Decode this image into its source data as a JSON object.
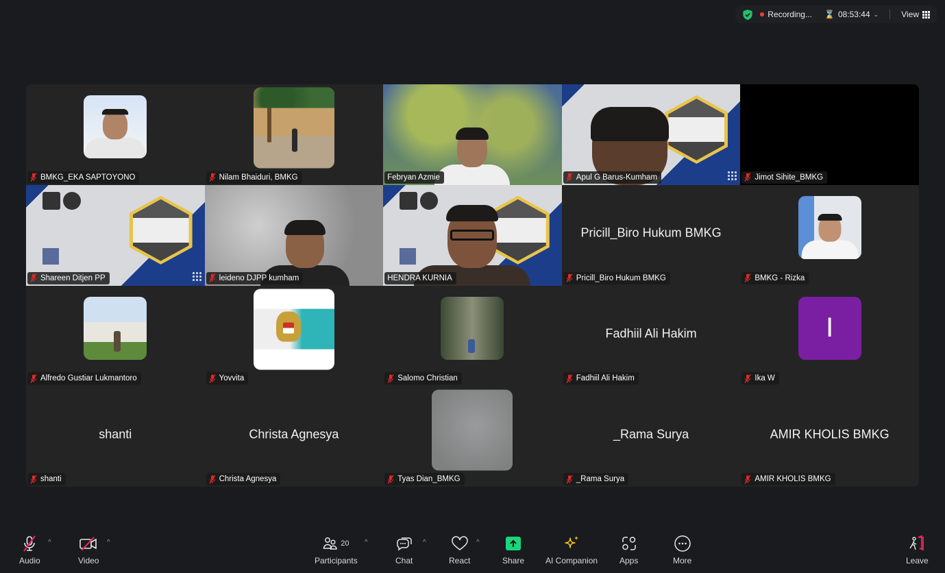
{
  "topbar": {
    "security_icon": "shield-check-icon",
    "recording_label": "Recording...",
    "timer": "08:53:44",
    "view_label": "View",
    "colors": {
      "shield": "#23c16b",
      "recording_dot": "#ff3b3b"
    }
  },
  "gallery": {
    "active_speaker": "HENDRA KURNIA",
    "active_border_color": "#23d959",
    "tiles": [
      {
        "name": "BMKG_EKA SAPTOYONO",
        "muted": true,
        "display": "avatar-photo"
      },
      {
        "name": "Nilam Bhaiduri, BMKG",
        "muted": true,
        "display": "avatar-photo"
      },
      {
        "name": "Febryan Azmie",
        "muted": false,
        "display": "video"
      },
      {
        "name": "Apul G Barus-Kumham",
        "muted": true,
        "display": "video"
      },
      {
        "name": "Jimot Sihite_BMKG",
        "muted": true,
        "display": "black-video"
      },
      {
        "name": "Shareen Ditjen PP",
        "muted": true,
        "display": "video"
      },
      {
        "name": "leideno DJPP kumham",
        "muted": true,
        "display": "video"
      },
      {
        "name": "HENDRA KURNIA",
        "muted": false,
        "display": "video"
      },
      {
        "name": "Pricill_Biro Hukum BMKG",
        "muted": true,
        "display": "name-only",
        "center_name": "Pricill_Biro Hukum BMKG"
      },
      {
        "name": "BMKG - Rizka",
        "muted": true,
        "display": "avatar-photo"
      },
      {
        "name": "Alfredo Gustiar Lukmantoro",
        "muted": true,
        "display": "avatar-photo"
      },
      {
        "name": "Yovvita",
        "muted": true,
        "display": "avatar-photo"
      },
      {
        "name": "Salomo Christian",
        "muted": true,
        "display": "avatar-photo"
      },
      {
        "name": "Fadhiil Ali Hakim",
        "muted": true,
        "display": "name-only",
        "center_name": "Fadhiil Ali Hakim"
      },
      {
        "name": "Ika W",
        "muted": true,
        "display": "avatar-letter",
        "avatar_letter": "I",
        "avatar_color": "#7a1fa2"
      },
      {
        "name": "shanti",
        "muted": true,
        "display": "name-only",
        "center_name": "shanti"
      },
      {
        "name": "Christa Agnesya",
        "muted": true,
        "display": "name-only",
        "center_name": "Christa Agnesya"
      },
      {
        "name": "Tyas Dian_BMKG",
        "muted": true,
        "display": "avatar-photo"
      },
      {
        "name": "_Rama Surya",
        "muted": true,
        "display": "name-only",
        "center_name": "_Rama Surya"
      },
      {
        "name": "AMIR KHOLIS BMKG",
        "muted": true,
        "display": "name-only",
        "center_name": "AMIR KHOLIS BMKG"
      }
    ]
  },
  "toolbar": {
    "audio": {
      "label": "Audio",
      "icon": "microphone-muted-icon"
    },
    "video": {
      "label": "Video",
      "icon": "camera-off-icon"
    },
    "participants": {
      "label": "Participants",
      "count": "20",
      "icon": "participants-icon"
    },
    "chat": {
      "label": "Chat",
      "icon": "chat-icon"
    },
    "react": {
      "label": "React",
      "icon": "heart-icon"
    },
    "share": {
      "label": "Share",
      "icon": "share-screen-icon",
      "color": "#19d67c"
    },
    "ai_companion": {
      "label": "AI Companion",
      "icon": "sparkle-icon",
      "color": "#f5c518"
    },
    "apps": {
      "label": "Apps",
      "icon": "apps-icon"
    },
    "more": {
      "label": "More",
      "icon": "more-ellipsis-icon"
    },
    "leave": {
      "label": "Leave",
      "icon": "leave-door-icon",
      "color": "#e8254f"
    }
  }
}
